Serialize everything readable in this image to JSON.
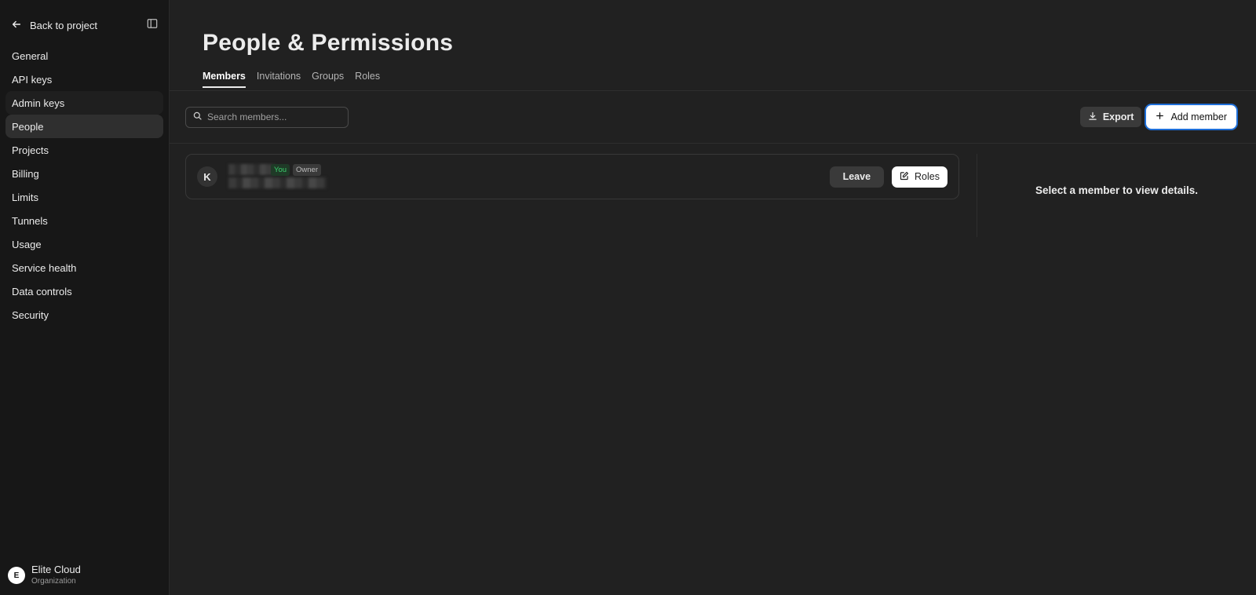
{
  "sidebar": {
    "back_label": "Back to project",
    "items": [
      {
        "label": "General"
      },
      {
        "label": "API keys"
      },
      {
        "label": "Admin keys"
      },
      {
        "label": "People"
      },
      {
        "label": "Projects"
      },
      {
        "label": "Billing"
      },
      {
        "label": "Limits"
      },
      {
        "label": "Tunnels"
      },
      {
        "label": "Usage"
      },
      {
        "label": "Service health"
      },
      {
        "label": "Data controls"
      },
      {
        "label": "Security"
      }
    ],
    "active_item": "People",
    "org": {
      "initial": "E",
      "name": "Elite Cloud",
      "type": "Organization"
    }
  },
  "header": {
    "title": "People & Permissions",
    "tabs": [
      {
        "label": "Members"
      },
      {
        "label": "Invitations"
      },
      {
        "label": "Groups"
      },
      {
        "label": "Roles"
      }
    ],
    "active_tab": "Members"
  },
  "toolbar": {
    "search_placeholder": "Search members...",
    "export_label": "Export",
    "add_member_label": "Add member"
  },
  "members": [
    {
      "initial": "K",
      "badge_you": "You",
      "badge_role": "Owner",
      "leave_label": "Leave",
      "roles_label": "Roles"
    }
  ],
  "details": {
    "empty_text": "Select a member to view details."
  },
  "colors": {
    "background": "#212121",
    "sidebar": "#171717",
    "accent_focus": "#1e6fd9",
    "you_badge": "#3ccf6e"
  }
}
